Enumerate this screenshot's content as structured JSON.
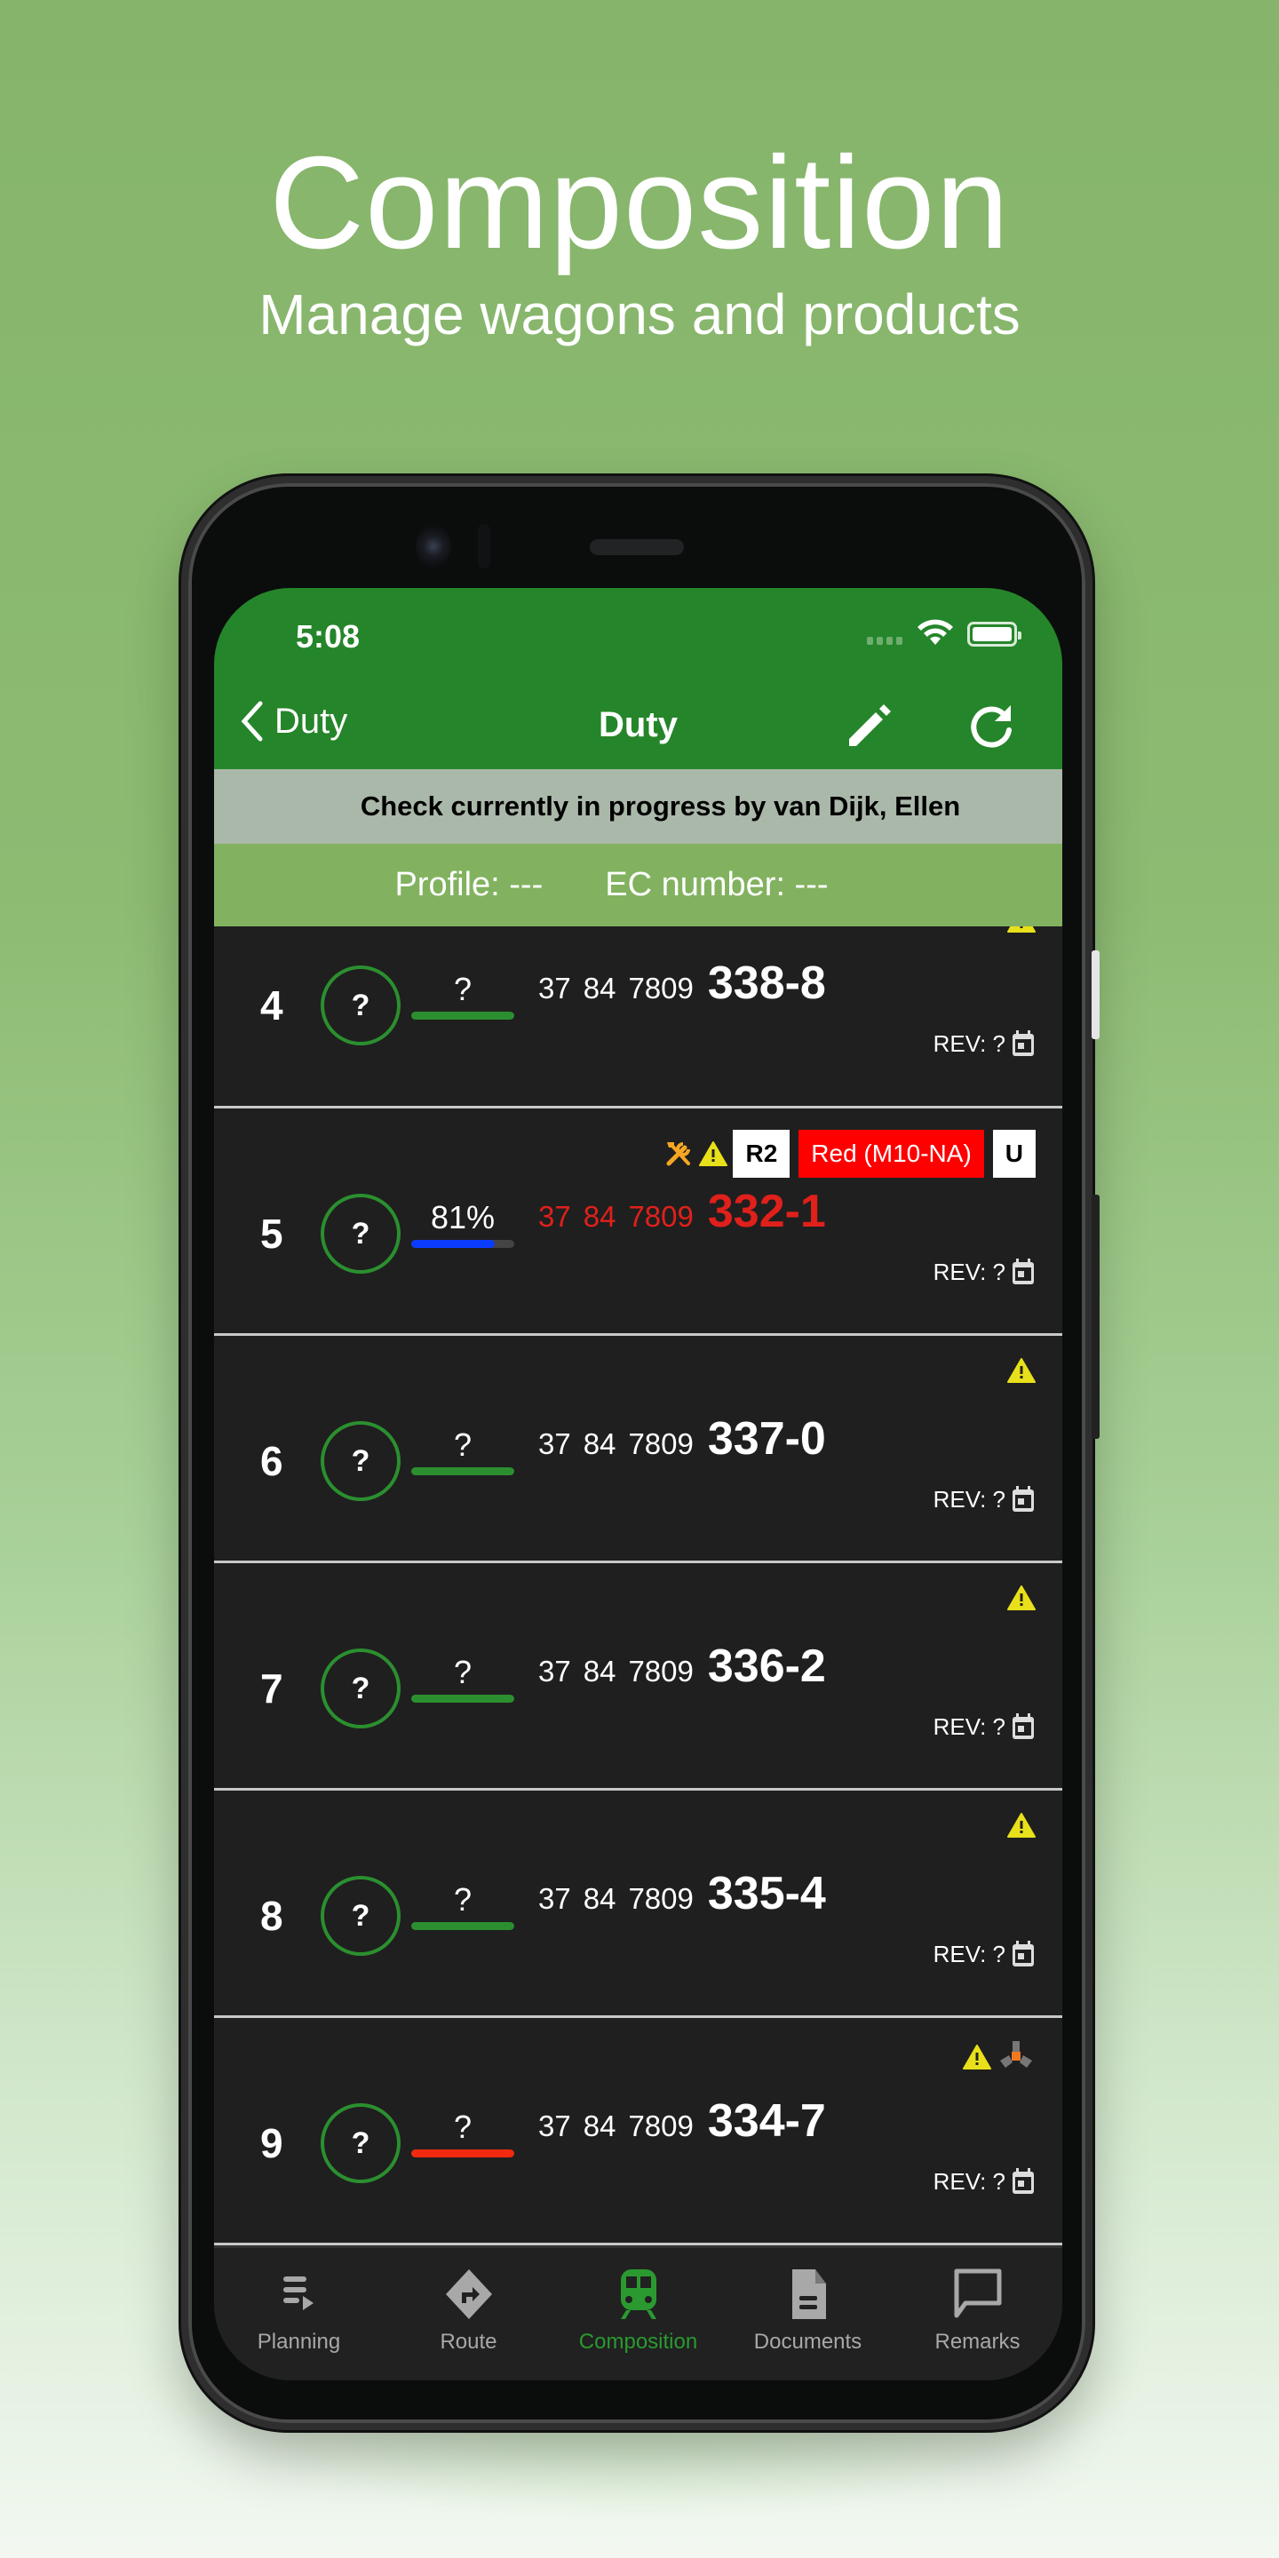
{
  "promo": {
    "title": "Composition",
    "subtitle": "Manage wagons and products"
  },
  "status_bar": {
    "time": "5:08"
  },
  "nav": {
    "back_label": "Duty",
    "title": "Duty",
    "edit_icon": "pencil-icon",
    "refresh_icon": "refresh-icon"
  },
  "banner": {
    "text": "Check currently in progress by van Dijk, Ellen"
  },
  "info": {
    "profile": "Profile: ---",
    "ec_number": "EC number: ---"
  },
  "colors": {
    "brand_green": "#25852a",
    "info_green": "#82b25f",
    "banner_gray": "#aab8a9",
    "list_bg": "#1f1f1f",
    "progress_green": "#2b8f2f",
    "progress_blue": "#0a3cff",
    "progress_red": "#f02a10",
    "alert_red": "#ff0000",
    "warning_yellow": "#e8e01a",
    "tool_orange": "#f5a623"
  },
  "wagons": [
    {
      "index": "4",
      "status": "?",
      "progress_label": "?",
      "progress": 1.0,
      "progress_color": "#2b8f2f",
      "number_parts": [
        "37",
        "84",
        "7809"
      ],
      "number_main": "338-8",
      "highlight": false,
      "icons": [
        "warning-icon"
      ],
      "tags": [],
      "rev": "REV: ?"
    },
    {
      "index": "5",
      "status": "?",
      "progress_label": "81%",
      "progress": 0.81,
      "progress_color": "#0a3cff",
      "number_parts": [
        "37",
        "84",
        "7809"
      ],
      "number_main": "332-1",
      "highlight": true,
      "icons": [
        "tools-icon",
        "warning-icon"
      ],
      "tags": [
        {
          "label": "R2",
          "style": "white"
        },
        {
          "label": "Red (M10-NA)",
          "style": "red"
        },
        {
          "label": "U",
          "style": "white"
        }
      ],
      "rev": "REV: ?"
    },
    {
      "index": "6",
      "status": "?",
      "progress_label": "?",
      "progress": 1.0,
      "progress_color": "#2b8f2f",
      "number_parts": [
        "37",
        "84",
        "7809"
      ],
      "number_main": "337-0",
      "highlight": false,
      "icons": [
        "warning-icon"
      ],
      "tags": [],
      "rev": "REV: ?"
    },
    {
      "index": "7",
      "status": "?",
      "progress_label": "?",
      "progress": 1.0,
      "progress_color": "#2b8f2f",
      "number_parts": [
        "37",
        "84",
        "7809"
      ],
      "number_main": "336-2",
      "highlight": false,
      "icons": [
        "warning-icon"
      ],
      "tags": [],
      "rev": "REV: ?"
    },
    {
      "index": "8",
      "status": "?",
      "progress_label": "?",
      "progress": 1.0,
      "progress_color": "#2b8f2f",
      "number_parts": [
        "37",
        "84",
        "7809"
      ],
      "number_main": "335-4",
      "highlight": false,
      "icons": [
        "warning-icon"
      ],
      "tags": [],
      "rev": "REV: ?"
    },
    {
      "index": "9",
      "status": "?",
      "progress_label": "?",
      "progress": 1.0,
      "progress_color": "#f02a10",
      "number_parts": [
        "37",
        "84",
        "7809"
      ],
      "number_main": "334-7",
      "highlight": false,
      "icons": [
        "warning-icon",
        "hazard-connector-icon"
      ],
      "tags": [],
      "rev": "REV: ?"
    }
  ],
  "tabs": [
    {
      "label": "Planning",
      "icon": "planning-list-icon",
      "active": false
    },
    {
      "label": "Route",
      "icon": "route-diamond-icon",
      "active": false
    },
    {
      "label": "Composition",
      "icon": "train-icon",
      "active": true
    },
    {
      "label": "Documents",
      "icon": "document-icon",
      "active": false
    },
    {
      "label": "Remarks",
      "icon": "comment-icon",
      "active": false
    }
  ]
}
